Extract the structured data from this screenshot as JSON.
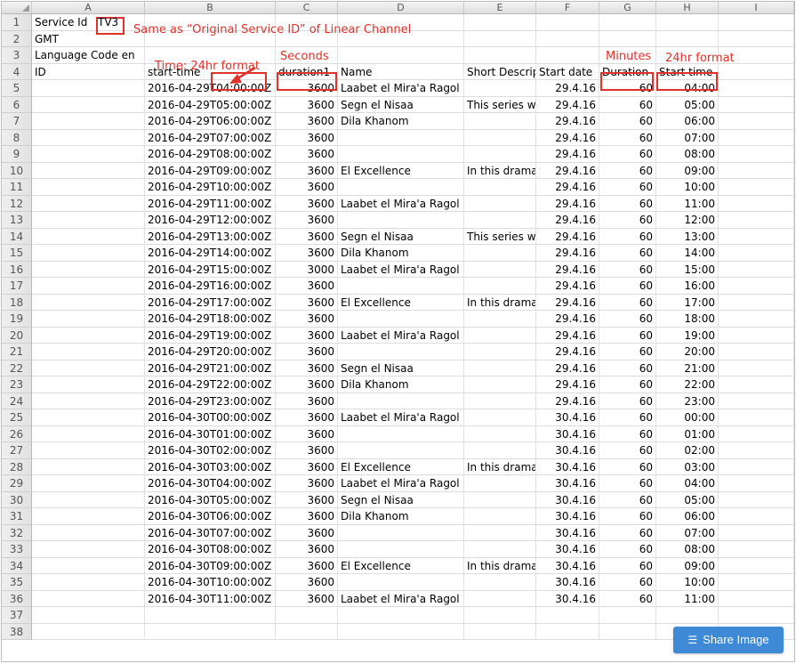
{
  "columns": [
    "A",
    "B",
    "C",
    "D",
    "E",
    "F",
    "G",
    "H",
    "I"
  ],
  "rows": [
    {
      "n": "1",
      "a": "Service Id",
      "a2": "TV3",
      "b": "",
      "c": "",
      "d": "",
      "e": "",
      "f": "",
      "g": "",
      "h": ""
    },
    {
      "n": "2",
      "a": "GMT",
      "b": "",
      "c": "",
      "d": "",
      "e": "",
      "f": "",
      "g": "",
      "h": ""
    },
    {
      "n": "3",
      "a": "Language Code en",
      "b": "",
      "c": "",
      "d": "",
      "e": "",
      "f": "",
      "g": "",
      "h": ""
    },
    {
      "n": "4",
      "a": "ID",
      "b": "start-time",
      "c": "duration1",
      "d": "Name",
      "e": "Short Descrip",
      "f": "Start date",
      "g": "Duration",
      "h": "Start time"
    },
    {
      "n": "5",
      "a": "",
      "b": "2016-04-29T04:00:00Z",
      "c": "3600",
      "d": "Laabet el Mira'a Ragol",
      "e": "",
      "f": "29.4.16",
      "g": "60",
      "h": "04:00"
    },
    {
      "n": "6",
      "a": "",
      "b": "2016-04-29T05:00:00Z",
      "c": "3600",
      "d": "Segn el Nisaa",
      "e": "This series w",
      "f": "29.4.16",
      "g": "60",
      "h": "05:00"
    },
    {
      "n": "7",
      "a": "",
      "b": "2016-04-29T06:00:00Z",
      "c": "3600",
      "d": "Dila Khanom",
      "e": "",
      "f": "29.4.16",
      "g": "60",
      "h": "06:00"
    },
    {
      "n": "8",
      "a": "",
      "b": "2016-04-29T07:00:00Z",
      "c": "3600",
      "d": "",
      "e": "",
      "f": "29.4.16",
      "g": "60",
      "h": "07:00"
    },
    {
      "n": "9",
      "a": "",
      "b": "2016-04-29T08:00:00Z",
      "c": "3600",
      "d": "",
      "e": "",
      "f": "29.4.16",
      "g": "60",
      "h": "08:00"
    },
    {
      "n": "10",
      "a": "",
      "b": "2016-04-29T09:00:00Z",
      "c": "3600",
      "d": "El Excellence",
      "e": "In this drama",
      "f": "29.4.16",
      "g": "60",
      "h": "09:00"
    },
    {
      "n": "11",
      "a": "",
      "b": "2016-04-29T10:00:00Z",
      "c": "3600",
      "d": "",
      "e": "",
      "f": "29.4.16",
      "g": "60",
      "h": "10:00"
    },
    {
      "n": "12",
      "a": "",
      "b": "2016-04-29T11:00:00Z",
      "c": "3600",
      "d": "Laabet el Mira'a Ragol",
      "e": "",
      "f": "29.4.16",
      "g": "60",
      "h": "11:00"
    },
    {
      "n": "13",
      "a": "",
      "b": "2016-04-29T12:00:00Z",
      "c": "3600",
      "d": "",
      "e": "",
      "f": "29.4.16",
      "g": "60",
      "h": "12:00"
    },
    {
      "n": "14",
      "a": "",
      "b": "2016-04-29T13:00:00Z",
      "c": "3600",
      "d": "Segn el Nisaa",
      "e": "This series w",
      "f": "29.4.16",
      "g": "60",
      "h": "13:00"
    },
    {
      "n": "15",
      "a": "",
      "b": "2016-04-29T14:00:00Z",
      "c": "3600",
      "d": "Dila Khanom",
      "e": "",
      "f": "29.4.16",
      "g": "60",
      "h": "14:00"
    },
    {
      "n": "16",
      "a": "",
      "b": "2016-04-29T15:00:00Z",
      "c": "3000",
      "d": "Laabet el Mira'a Ragol",
      "e": "",
      "f": "29.4.16",
      "g": "60",
      "h": "15:00"
    },
    {
      "n": "17",
      "a": "",
      "b": "2016-04-29T16:00:00Z",
      "c": "3600",
      "d": "",
      "e": "",
      "f": "29.4.16",
      "g": "60",
      "h": "16:00"
    },
    {
      "n": "18",
      "a": "",
      "b": "2016-04-29T17:00:00Z",
      "c": "3600",
      "d": "El Excellence",
      "e": "In this drama",
      "f": "29.4.16",
      "g": "60",
      "h": "17:00"
    },
    {
      "n": "19",
      "a": "",
      "b": "2016-04-29T18:00:00Z",
      "c": "3600",
      "d": "",
      "e": "",
      "f": "29.4.16",
      "g": "60",
      "h": "18:00"
    },
    {
      "n": "20",
      "a": "",
      "b": "2016-04-29T19:00:00Z",
      "c": "3600",
      "d": "Laabet el Mira'a Ragol",
      "e": "",
      "f": "29.4.16",
      "g": "60",
      "h": "19:00"
    },
    {
      "n": "21",
      "a": "",
      "b": "2016-04-29T20:00:00Z",
      "c": "3600",
      "d": "",
      "e": "",
      "f": "29.4.16",
      "g": "60",
      "h": "20:00"
    },
    {
      "n": "22",
      "a": "",
      "b": "2016-04-29T21:00:00Z",
      "c": "3600",
      "d": "Segn el Nisaa",
      "e": "",
      "f": "29.4.16",
      "g": "60",
      "h": "21:00"
    },
    {
      "n": "23",
      "a": "",
      "b": "2016-04-29T22:00:00Z",
      "c": "3600",
      "d": "Dila Khanom",
      "e": "",
      "f": "29.4.16",
      "g": "60",
      "h": "22:00"
    },
    {
      "n": "24",
      "a": "",
      "b": "2016-04-29T23:00:00Z",
      "c": "3600",
      "d": "",
      "e": "",
      "f": "29.4.16",
      "g": "60",
      "h": "23:00"
    },
    {
      "n": "25",
      "a": "",
      "b": "2016-04-30T00:00:00Z",
      "c": "3600",
      "d": "Laabet el Mira'a Ragol",
      "e": "",
      "f": "30.4.16",
      "g": "60",
      "h": "00:00"
    },
    {
      "n": "26",
      "a": "",
      "b": "2016-04-30T01:00:00Z",
      "c": "3600",
      "d": "",
      "e": "",
      "f": "30.4.16",
      "g": "60",
      "h": "01:00"
    },
    {
      "n": "27",
      "a": "",
      "b": "2016-04-30T02:00:00Z",
      "c": "3600",
      "d": "",
      "e": "",
      "f": "30.4.16",
      "g": "60",
      "h": "02:00"
    },
    {
      "n": "28",
      "a": "",
      "b": "2016-04-30T03:00:00Z",
      "c": "3600",
      "d": "El Excellence",
      "e": "In this drama",
      "f": "30.4.16",
      "g": "60",
      "h": "03:00"
    },
    {
      "n": "29",
      "a": "",
      "b": "2016-04-30T04:00:00Z",
      "c": "3600",
      "d": "Laabet el Mira'a Ragol",
      "e": "",
      "f": "30.4.16",
      "g": "60",
      "h": "04:00"
    },
    {
      "n": "30",
      "a": "",
      "b": "2016-04-30T05:00:00Z",
      "c": "3600",
      "d": "Segn el Nisaa",
      "e": "",
      "f": "30.4.16",
      "g": "60",
      "h": "05:00"
    },
    {
      "n": "31",
      "a": "",
      "b": "2016-04-30T06:00:00Z",
      "c": "3600",
      "d": "Dila Khanom",
      "e": "",
      "f": "30.4.16",
      "g": "60",
      "h": "06:00"
    },
    {
      "n": "32",
      "a": "",
      "b": "2016-04-30T07:00:00Z",
      "c": "3600",
      "d": "",
      "e": "",
      "f": "30.4.16",
      "g": "60",
      "h": "07:00"
    },
    {
      "n": "33",
      "a": "",
      "b": "2016-04-30T08:00:00Z",
      "c": "3600",
      "d": "",
      "e": "",
      "f": "30.4.16",
      "g": "60",
      "h": "08:00"
    },
    {
      "n": "34",
      "a": "",
      "b": "2016-04-30T09:00:00Z",
      "c": "3600",
      "d": "El Excellence",
      "e": "In this drama",
      "f": "30.4.16",
      "g": "60",
      "h": "09:00"
    },
    {
      "n": "35",
      "a": "",
      "b": "2016-04-30T10:00:00Z",
      "c": "3600",
      "d": "",
      "e": "",
      "f": "30.4.16",
      "g": "60",
      "h": "10:00"
    },
    {
      "n": "36",
      "a": "",
      "b": "2016-04-30T11:00:00Z",
      "c": "3600",
      "d": "Laabet el Mira'a Ragol",
      "e": "",
      "f": "30.4.16",
      "g": "60",
      "h": "11:00"
    },
    {
      "n": "37",
      "a": "",
      "b": "",
      "c": "",
      "d": "",
      "e": "",
      "f": "",
      "g": "",
      "h": ""
    },
    {
      "n": "38",
      "a": "",
      "b": "",
      "c": "",
      "d": "",
      "e": "",
      "f": "",
      "g": "",
      "h": ""
    }
  ],
  "annotations": {
    "service_id": "Same as “Original Service ID” of Linear Channel",
    "time": "Time: 24hr format",
    "seconds": "Seconds",
    "minutes": "Minutes",
    "start_time_format": "24hr format"
  },
  "share_button": {
    "label": "Share Image",
    "icon": "stack-icon"
  },
  "colors": {
    "annotation": "#e0322a",
    "share_button": "#3e8ad6"
  }
}
